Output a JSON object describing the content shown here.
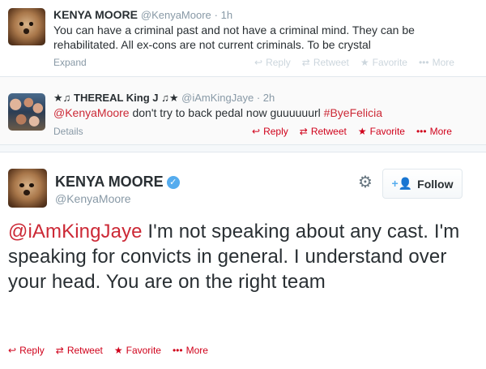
{
  "tweet1": {
    "name": "KENYA MOORE",
    "handle": "@KenyaMoore",
    "time": "· 1h",
    "text": "You can have a criminal past and not have a criminal mind. They can be rehabilitated. All ex-cons are not current criminals. To be crystal",
    "expand": "Expand",
    "actions": {
      "reply": "Reply",
      "retweet": "Retweet",
      "favorite": "Favorite",
      "more": "More"
    }
  },
  "tweet2": {
    "name": "★♫ THEREAL King J ♫★",
    "handle": "@iAmKingJaye",
    "time": "· 2h",
    "mention": "@KenyaMoore",
    "text": " don't try to back pedal now guuuuuurl ",
    "hashtag": "#ByeFelicia",
    "details": "Details",
    "actions": {
      "reply": "Reply",
      "retweet": "Retweet",
      "favorite": "Favorite",
      "more": "More"
    }
  },
  "tweet3": {
    "name": "KENYA MOORE",
    "handle": "@KenyaMoore",
    "follow_label": "Follow",
    "mention": "@iAmKingJaye",
    "text": "  I'm not speaking about any cast. I'm speaking for convicts in general. I understand over your head. You are on the right team",
    "actions": {
      "reply": "Reply",
      "retweet": "Retweet",
      "favorite": "Favorite",
      "more": "More"
    }
  },
  "icons": {
    "reply": "reply-icon",
    "retweet": "retweet-icon",
    "favorite": "star-icon",
    "more": "ellipsis-icon",
    "settings": "gear-icon",
    "follow": "add-user-icon",
    "verified": "verified-badge-icon"
  },
  "colors": {
    "accent_red": "#d0021b",
    "link_red": "#e0245e",
    "muted": "#8899a6",
    "verified_blue": "#55acee"
  }
}
